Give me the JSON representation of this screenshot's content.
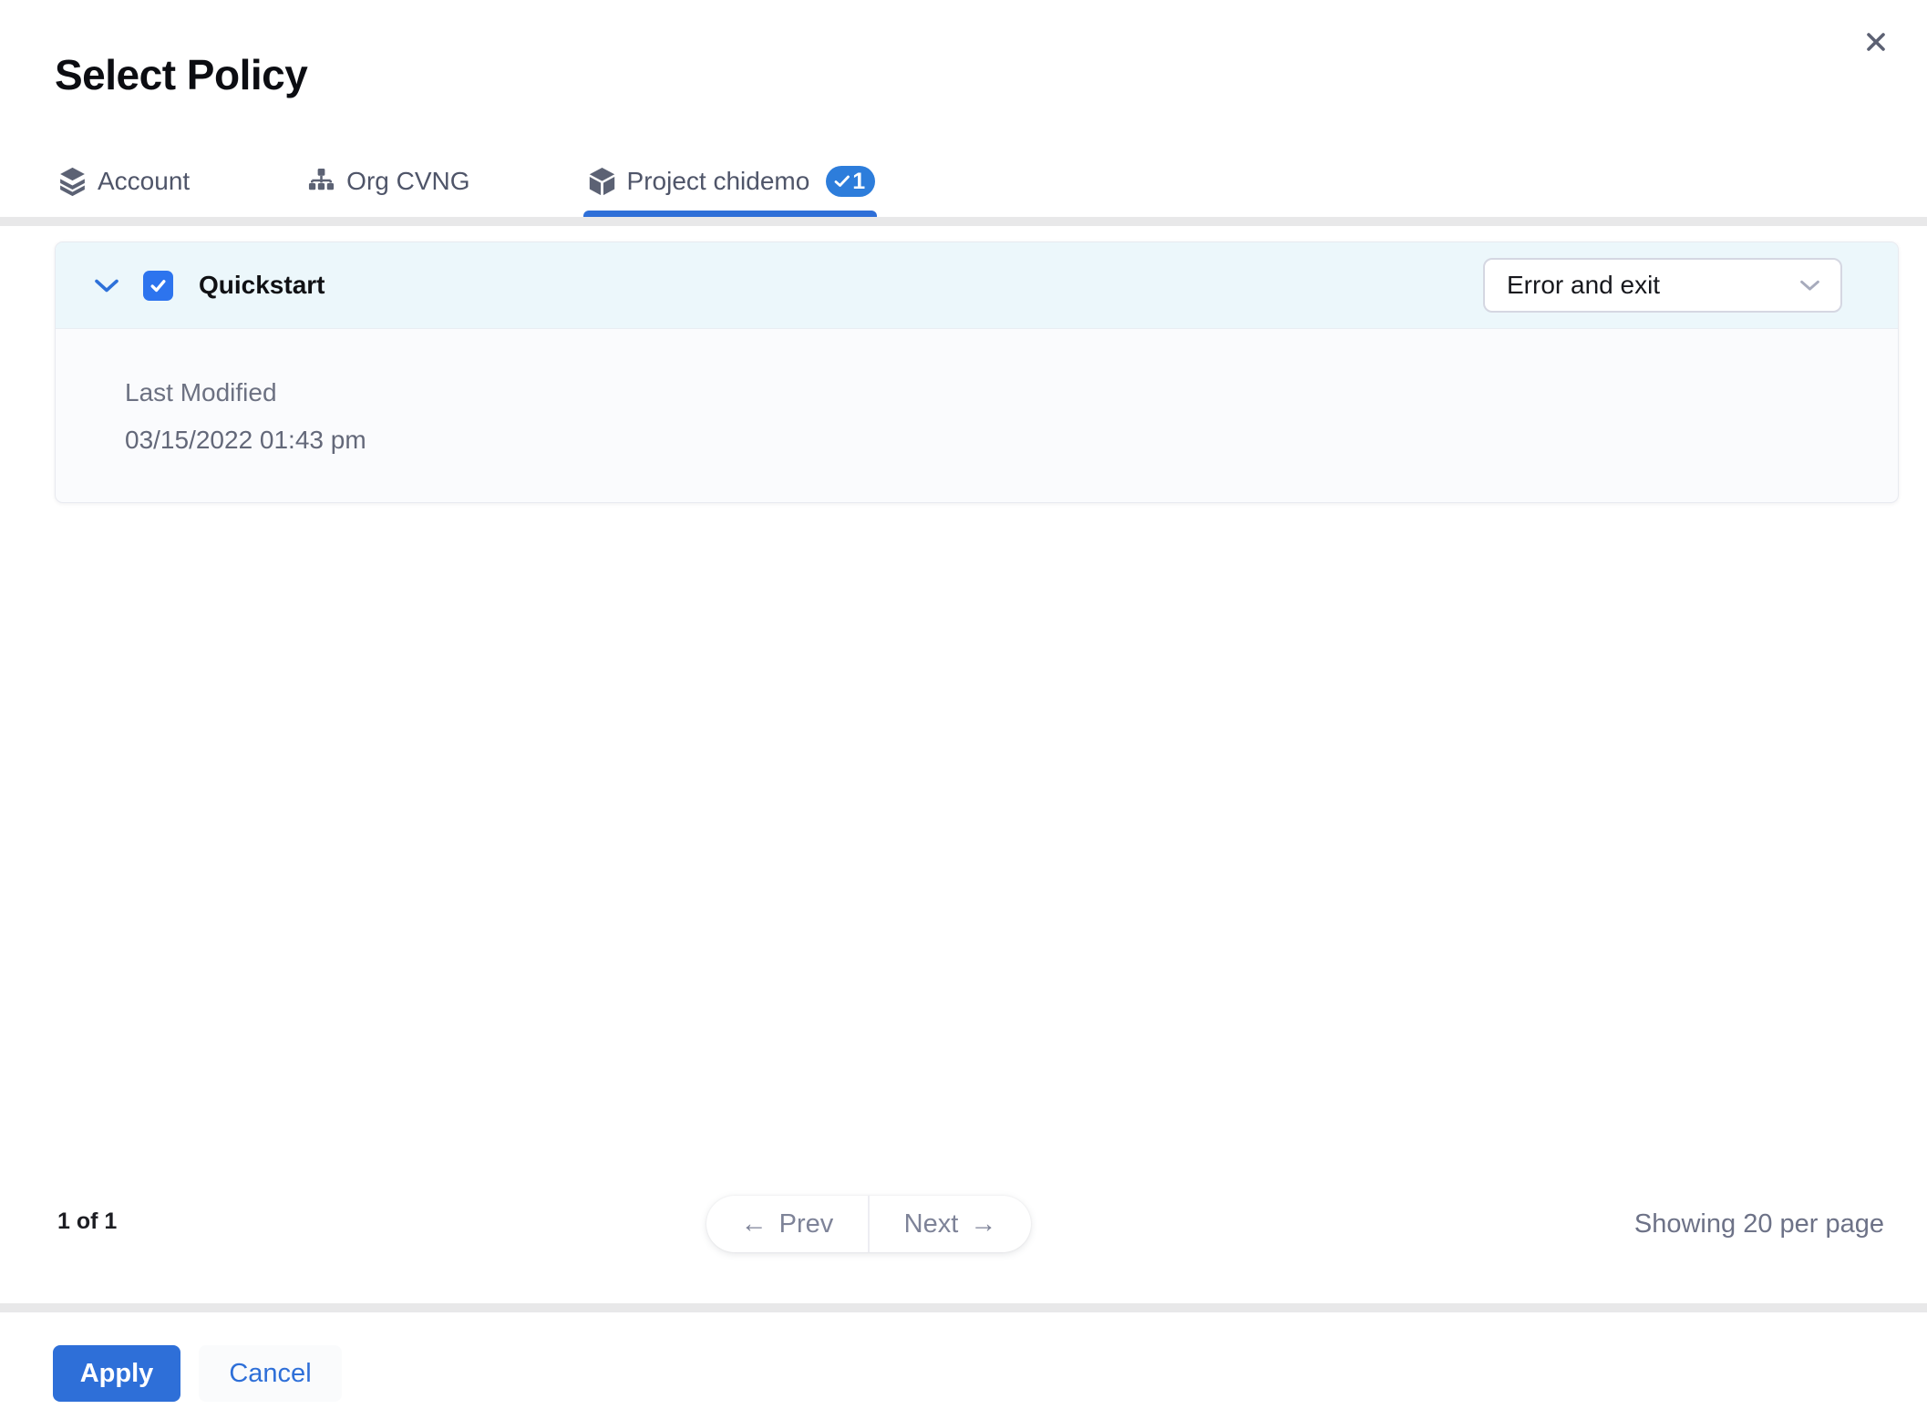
{
  "dialog": {
    "title": "Select Policy"
  },
  "tabs": [
    {
      "label": "Account"
    },
    {
      "label": "Org CVNG"
    },
    {
      "label": "Project chidemo",
      "badge_count": "1"
    }
  ],
  "policy_row": {
    "name": "Quickstart",
    "checked": true,
    "expanded": true,
    "severity_select": {
      "value": "Error and exit"
    },
    "details": [
      {
        "label": "Last Modified",
        "value": "03/15/2022 01:43 pm"
      }
    ]
  },
  "pagination": {
    "summary": "1 of 1",
    "prev_arrow": "←",
    "prev": "Prev",
    "next": "Next",
    "next_arrow": "→",
    "per_page": "Showing 20 per page"
  },
  "actions": {
    "apply": "Apply",
    "cancel": "Cancel"
  },
  "colors": {
    "primary_blue": "#2e6fd8",
    "badge_blue": "#2d7ddb",
    "checkbox_blue": "#2d74ee",
    "row_highlight": "#ecf7fb",
    "card_background": "#fafbfd",
    "divider_gray": "#e8e8e9",
    "tab_text": "#4f5569",
    "muted_text": "#6c7182"
  }
}
